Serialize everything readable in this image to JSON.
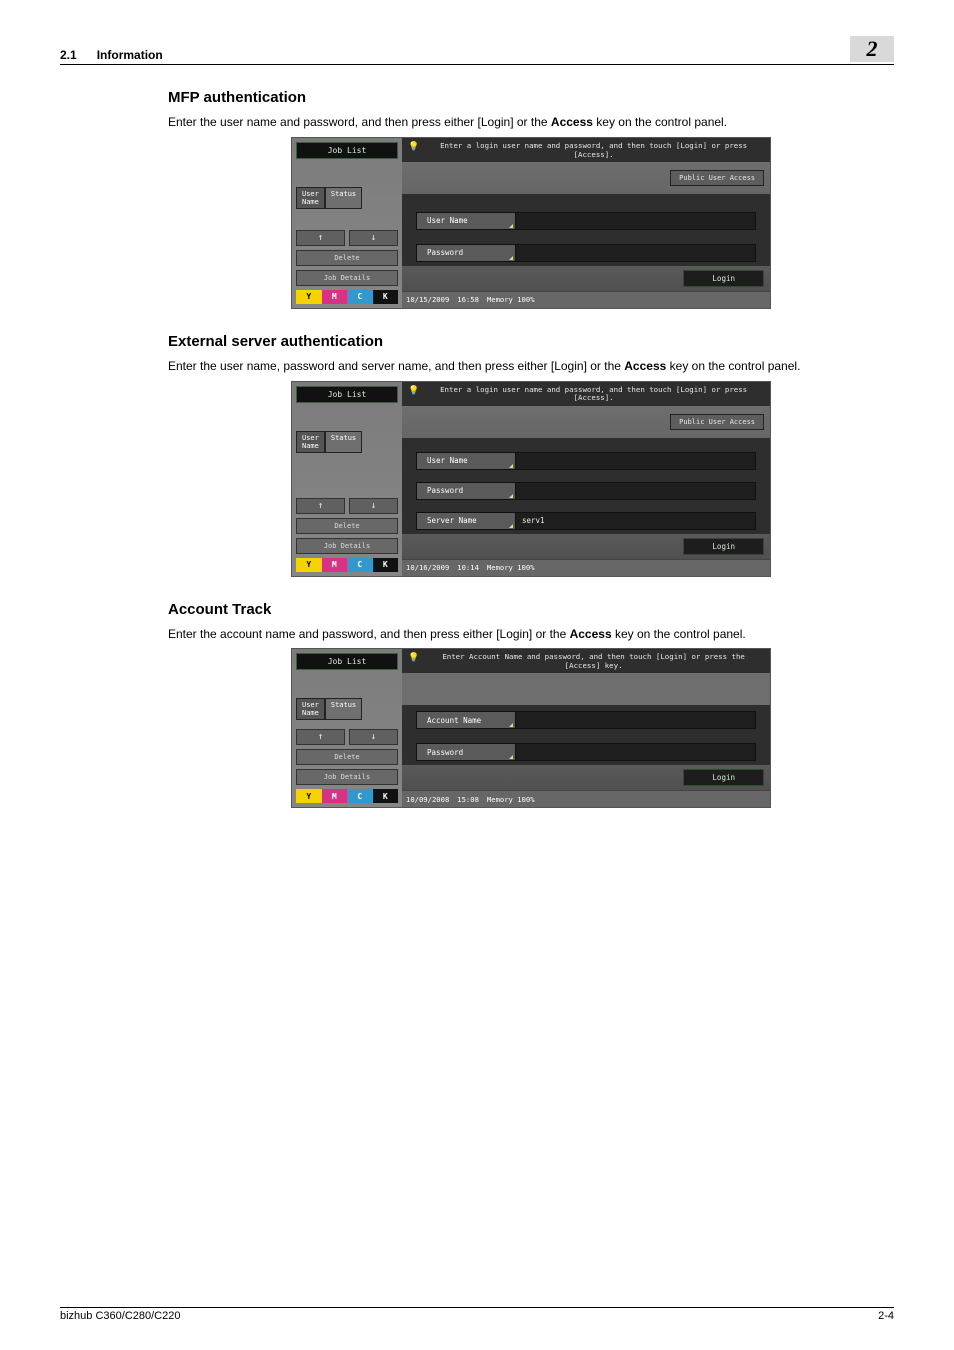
{
  "page": {
    "section_no": "2.1",
    "section_title": "Information",
    "chapter_no": "2",
    "footer_left": "bizhub C360/C280/C220",
    "footer_right": "2-4"
  },
  "sections": {
    "mfp": {
      "heading": "MFP authentication",
      "body": "Enter the user name and password, and then press either [Login] or the Access key on the control panel.",
      "body_html_prefix": "Enter the user name and password, and then press either [Login] or the ",
      "body_bold": "Access",
      "body_html_suffix": " key on the control panel."
    },
    "ext": {
      "heading": "External server authentication",
      "body_prefix": "Enter the user name, password and server name, and then press either [Login] or the ",
      "body_bold": "Access",
      "body_suffix": " key on the control panel."
    },
    "acct": {
      "heading": "Account Track",
      "body_prefix": "Enter the account name and password, and then press either [Login] or the ",
      "body_bold": "Access",
      "body_suffix": " key on the control panel."
    }
  },
  "screens": {
    "common": {
      "job_list": "Job List",
      "tab_user": "User\nName",
      "tab_status": "Status",
      "delete": "Delete",
      "job_details": "Job Details",
      "login": "Login",
      "pub_access": "Public User Access",
      "memory_label": "Memory",
      "memory_value": "100%",
      "toner": {
        "y": "Y",
        "m": "M",
        "c": "C",
        "k": "K"
      }
    },
    "mfp": {
      "tip": "Enter a login user name and password, and then touch [Login] or press [Access].",
      "user_name": "User Name",
      "password": "Password",
      "date": "10/15/2009",
      "time": "16:58"
    },
    "ext": {
      "tip": "Enter a login user name and password, and then touch [Login] or press [Access].",
      "user_name": "User Name",
      "password": "Password",
      "server_name": "Server Name",
      "server_value": "serv1",
      "date": "10/16/2009",
      "time": "10:14"
    },
    "acct": {
      "tip": "Enter Account Name and password, and then touch [Login] or press the [Access] key.",
      "account_name": "Account Name",
      "password": "Password",
      "date": "10/09/2008",
      "time": "15:08"
    }
  }
}
